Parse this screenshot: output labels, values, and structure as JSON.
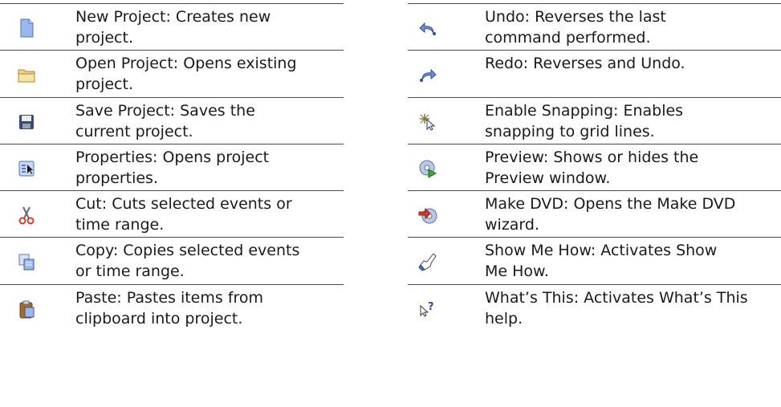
{
  "left_column": [
    {
      "icon": "new-project-icon",
      "text": "New Project: Creates new\nproject."
    },
    {
      "icon": "open-folder-icon",
      "text": "Open Project: Opens existing\nproject."
    },
    {
      "icon": "save-disk-icon",
      "text": "Save Project: Saves the\ncurrent project."
    },
    {
      "icon": "properties-icon",
      "text": "Properties: Opens project\nproperties."
    },
    {
      "icon": "scissors-icon",
      "text": "Cut: Cuts selected events or\ntime range."
    },
    {
      "icon": "copy-icon",
      "text": "Copy: Copies selected events\nor time range."
    },
    {
      "icon": "clipboard-icon",
      "text": "Paste: Pastes items from\nclipboard into project."
    }
  ],
  "right_column": [
    {
      "icon": "undo-arrow-icon",
      "text": "Undo: Reverses the last\ncommand performed."
    },
    {
      "icon": "redo-arrow-icon",
      "text": "Redo: Reverses and Undo."
    },
    {
      "icon": "snapping-icon",
      "text": "Enable Snapping: Enables\nsnapping to grid lines."
    },
    {
      "icon": "preview-disc-icon",
      "text": "Preview: Shows or hides the\nPreview window."
    },
    {
      "icon": "make-dvd-icon",
      "text": "Make DVD: Opens the Make DVD\nwizard."
    },
    {
      "icon": "show-me-how-icon",
      "text": "Show Me How: Activates Show\nMe How."
    },
    {
      "icon": "whats-this-icon",
      "text": "What’s This: Activates What’s This\nhelp."
    }
  ]
}
